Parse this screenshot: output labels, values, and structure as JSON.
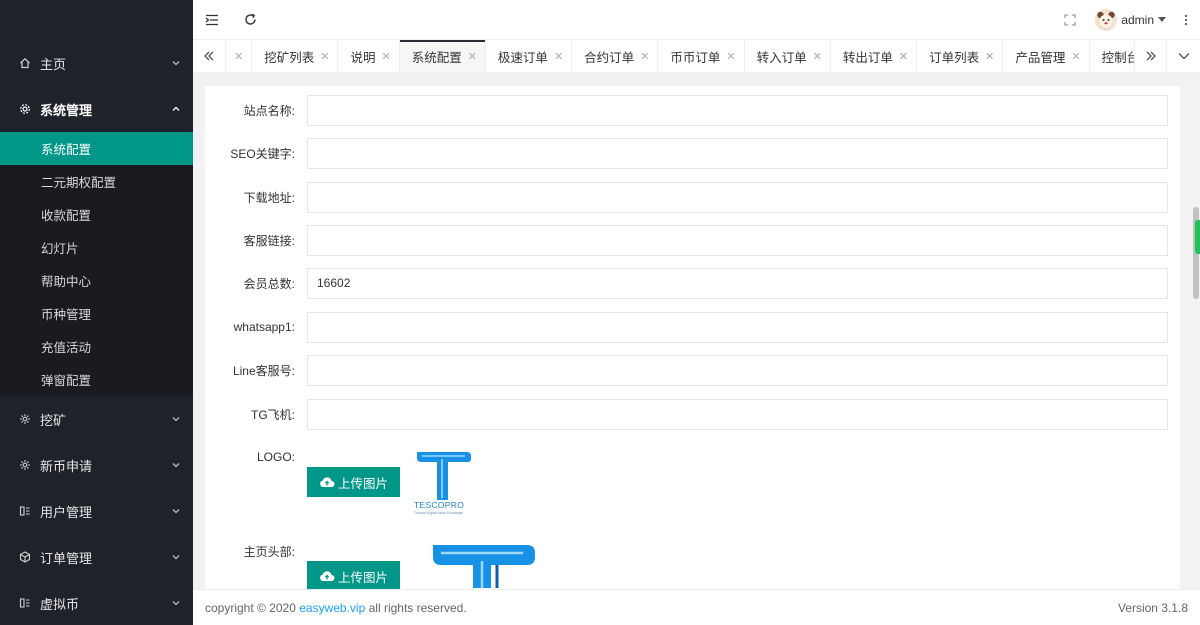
{
  "sidebar": {
    "groups": [
      {
        "label": "主页",
        "icon": "home-icon",
        "open": false
      },
      {
        "label": "系统管理",
        "icon": "gear-icon",
        "open": true,
        "items": [
          "系统配置",
          "二元期权配置",
          "收款配置",
          "幻灯片",
          "帮助中心",
          "币种管理",
          "充值活动",
          "弹窗配置"
        ],
        "active": "系统配置"
      },
      {
        "label": "挖矿",
        "icon": "cog-icon",
        "open": false
      },
      {
        "label": "新币申请",
        "icon": "cog-icon",
        "open": false
      },
      {
        "label": "用户管理",
        "icon": "users-icon",
        "open": false
      },
      {
        "label": "订单管理",
        "icon": "box-icon",
        "open": false
      },
      {
        "label": "虚拟币",
        "icon": "coin-icon",
        "open": false
      }
    ]
  },
  "header": {
    "user_name": "admin"
  },
  "tabs": {
    "items": [
      {
        "label": "挖矿列表"
      },
      {
        "label": "说明"
      },
      {
        "label": "系统配置",
        "active": true
      },
      {
        "label": "极速订单"
      },
      {
        "label": "合约订单"
      },
      {
        "label": "币币订单"
      },
      {
        "label": "转入订单"
      },
      {
        "label": "转出订单"
      },
      {
        "label": "订单列表"
      },
      {
        "label": "产品管理"
      },
      {
        "label": "控制台"
      }
    ]
  },
  "form": {
    "site_name_label": "站点名称:",
    "site_name_value": "",
    "seo_label": "SEO关键字:",
    "seo_value": "",
    "download_label": "下载地址:",
    "download_value": "",
    "service_link_label": "客服链接:",
    "service_link_value": "",
    "member_total_label": "会员总数:",
    "member_total_value": "16602",
    "whatsapp_label": "whatsapp1:",
    "whatsapp_value": "",
    "line_label": "Line客服号:",
    "line_value": "",
    "tg_label": "TG飞机:",
    "tg_value": "",
    "logo_label": "LOGO:",
    "header_label": "主页头部:",
    "upload_label": "上传图片",
    "logo_text": "TESCOPRO",
    "logo_tagline": "Trusted Digital Asset Exchange"
  },
  "footer": {
    "copyright_prefix": "copyright © 2020 ",
    "link_text": "easyweb.vip",
    "copyright_suffix": " all rights reserved.",
    "version": "Version 3.1.8"
  },
  "colors": {
    "accent": "#009688",
    "sidebar_bg": "#20222a",
    "logo_blue": "#0a7fd9"
  }
}
